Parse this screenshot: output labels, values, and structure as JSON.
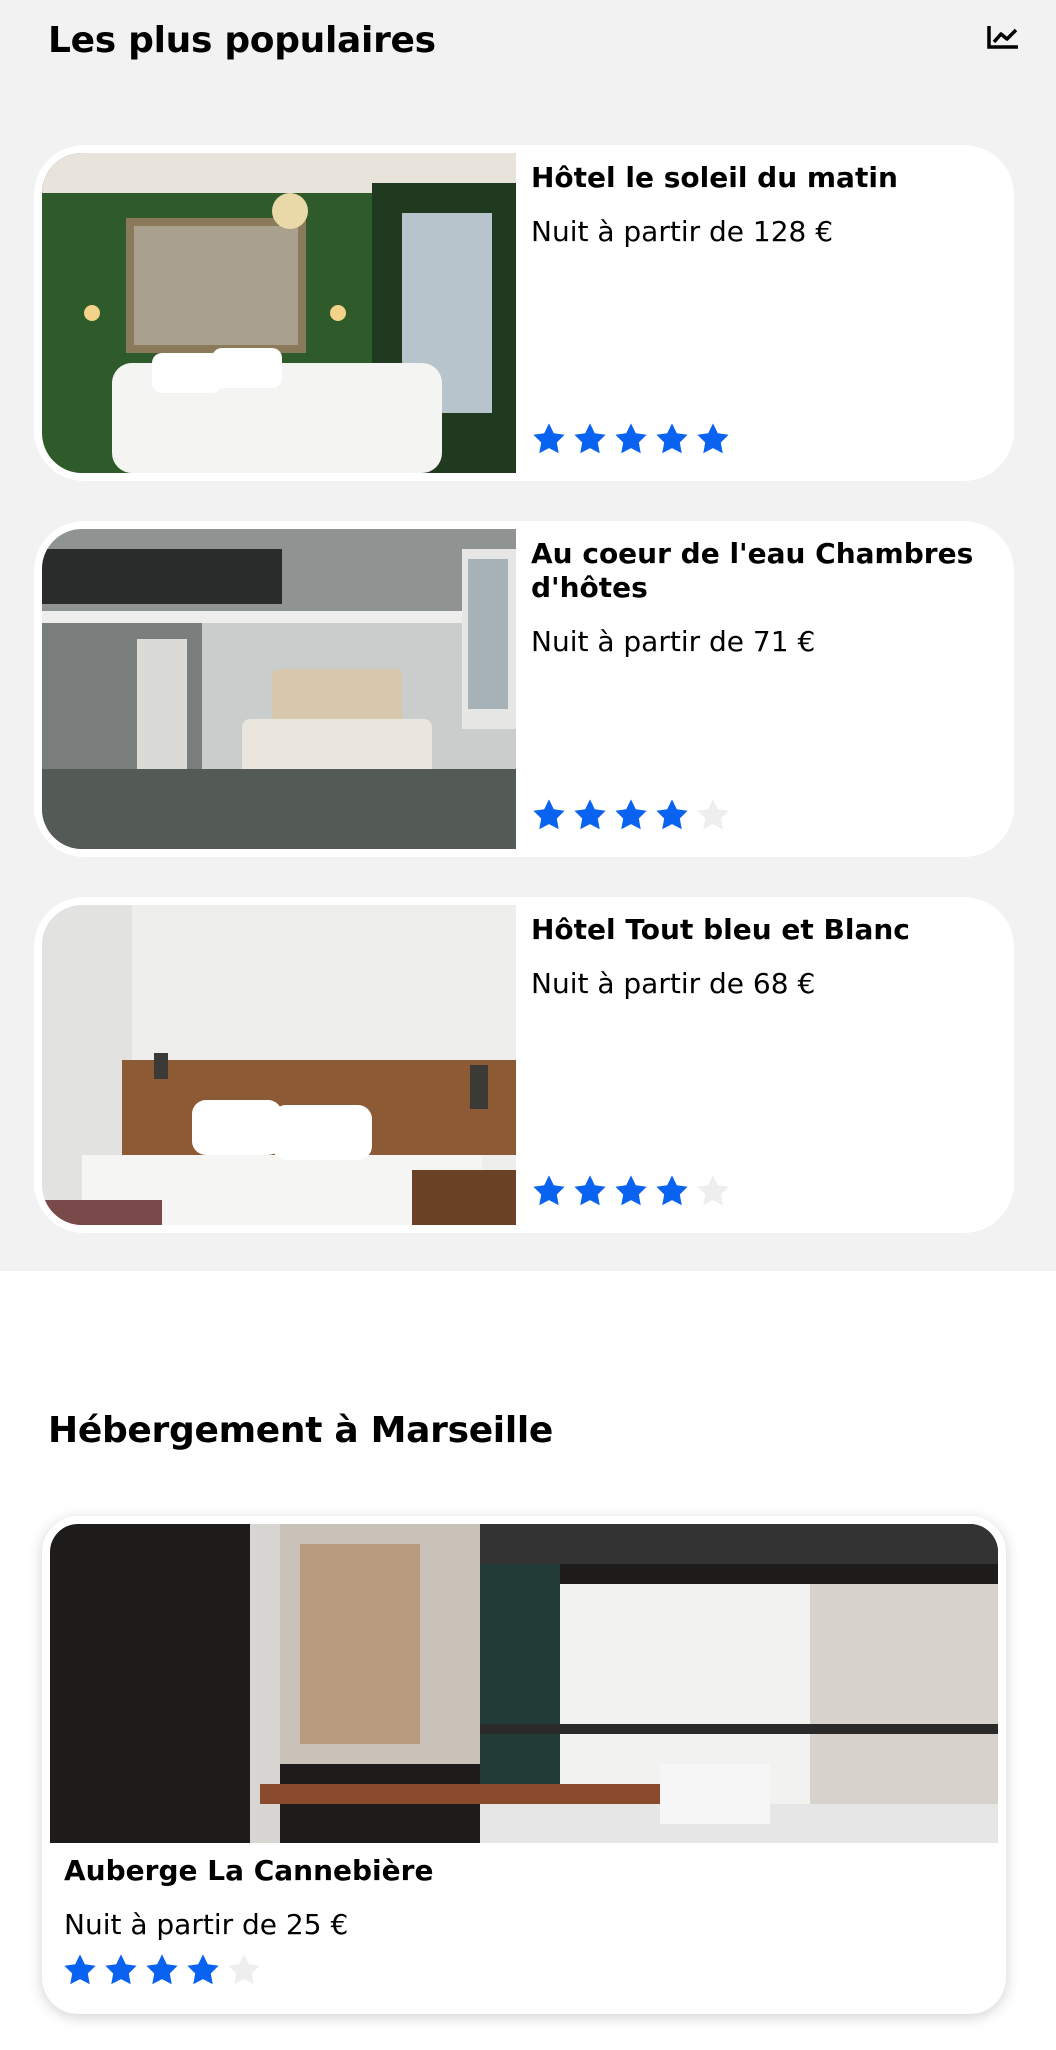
{
  "popular": {
    "title": "Les plus populaires",
    "icon": "trending-chart-icon",
    "hotels": [
      {
        "name": "Hôtel le soleil du matin",
        "price": "Nuit à partir de 128 €",
        "rating": 5,
        "max_rating": 5
      },
      {
        "name": "Au coeur de l'eau Chambres d'hôtes",
        "price": "Nuit à partir de 71 €",
        "rating": 4,
        "max_rating": 5
      },
      {
        "name": "Hôtel Tout bleu et Blanc",
        "price": "Nuit à partir de 68 €",
        "rating": 4,
        "max_rating": 5
      }
    ]
  },
  "city": {
    "title": "Hébergement à Marseille",
    "hotels": [
      {
        "name": "Auberge La Cannebière",
        "price": "Nuit à partir de 25 €",
        "rating": 4,
        "max_rating": 5
      }
    ]
  },
  "colors": {
    "star_on": "#0a63f0",
    "star_off": "#eeeeee",
    "section_bg": "#f2f2f2"
  }
}
